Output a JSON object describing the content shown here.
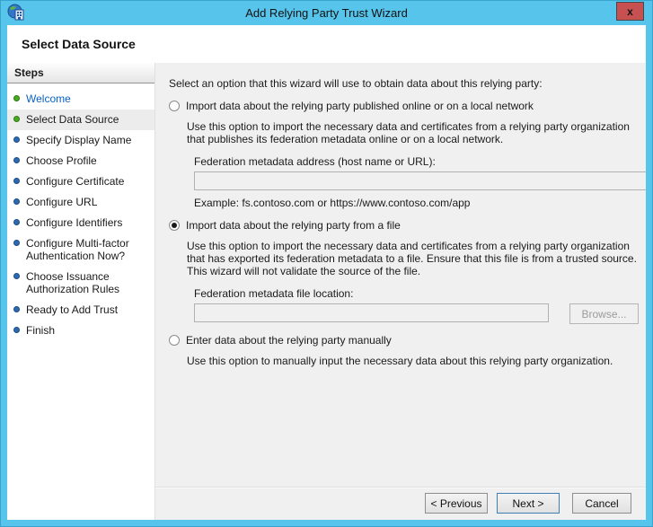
{
  "window": {
    "title": "Add Relying Party Trust Wizard",
    "close_label": "x",
    "page_title": "Select Data Source"
  },
  "sidebar": {
    "header": "Steps",
    "steps": [
      {
        "label": "Welcome",
        "state": "done",
        "current": false
      },
      {
        "label": "Select Data Source",
        "state": "done",
        "current": true
      },
      {
        "label": "Specify Display Name",
        "state": "todo",
        "current": false
      },
      {
        "label": "Choose Profile",
        "state": "todo",
        "current": false
      },
      {
        "label": "Configure Certificate",
        "state": "todo",
        "current": false
      },
      {
        "label": "Configure URL",
        "state": "todo",
        "current": false
      },
      {
        "label": "Configure Identifiers",
        "state": "todo",
        "current": false
      },
      {
        "label": "Configure Multi-factor Authentication Now?",
        "state": "todo",
        "current": false
      },
      {
        "label": "Choose Issuance Authorization Rules",
        "state": "todo",
        "current": false
      },
      {
        "label": "Ready to Add Trust",
        "state": "todo",
        "current": false
      },
      {
        "label": "Finish",
        "state": "todo",
        "current": false
      }
    ]
  },
  "content": {
    "intro": "Select an option that this wizard will use to obtain data about this relying party:",
    "options": [
      {
        "label": "Import data about the relying party published online or on a local network",
        "selected": false,
        "description": "Use this option to import the necessary data and certificates from a relying party organization that publishes its federation metadata online or on a local network.",
        "field_label": "Federation metadata address (host name or URL):",
        "field_value": "",
        "example": "Example: fs.contoso.com or https://www.contoso.com/app"
      },
      {
        "label": "Import data about the relying party from a file",
        "selected": true,
        "description": "Use this option to import the necessary data and certificates from a relying party organization that has exported its federation metadata to a file. Ensure that this file is from a trusted source.  This wizard will not validate the source of the file.",
        "field_label": "Federation metadata file location:",
        "field_value": "",
        "browse_label": "Browse..."
      },
      {
        "label": "Enter data about the relying party manually",
        "selected": false,
        "description": "Use this option to manually input the necessary data about this relying party organization."
      }
    ]
  },
  "footer": {
    "previous_label": "< Previous",
    "next_label": "Next >",
    "cancel_label": "Cancel"
  },
  "colors": {
    "titlebar_blue": "#57c4ec",
    "close_red": "#c75050",
    "content_gray": "#f0f0f0",
    "step_done_green": "#48ab20",
    "step_todo_blue": "#2c69b0",
    "link_blue": "#0a63c5",
    "next_button_border": "#3f7fb5",
    "disabled_text": "#9b9b9b"
  }
}
